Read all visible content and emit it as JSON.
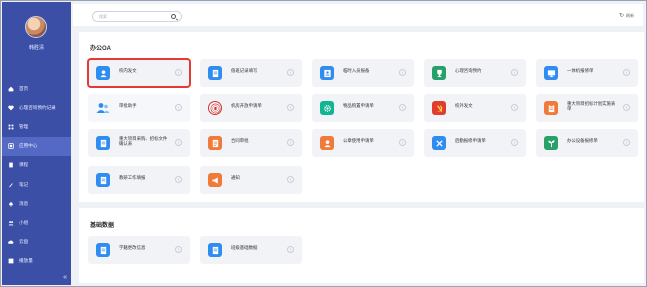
{
  "sidebar": {
    "username": "韩胜清",
    "items": [
      {
        "label": "首页",
        "icon": "home-icon"
      },
      {
        "label": "心理咨询预约记录",
        "icon": "heart-icon"
      },
      {
        "label": "管理",
        "icon": "grid-icon"
      },
      {
        "label": "应用中心",
        "icon": "apps-icon",
        "active": true
      },
      {
        "label": "课程",
        "icon": "book-icon"
      },
      {
        "label": "笔记",
        "icon": "pen-icon"
      },
      {
        "label": "消息",
        "icon": "bell-icon"
      },
      {
        "label": "小组",
        "icon": "group-icon"
      },
      {
        "label": "云盘",
        "icon": "cloud-icon"
      },
      {
        "label": "播放量",
        "icon": "chart-icon"
      }
    ],
    "collapse_label": "«"
  },
  "topbar": {
    "search_placeholder": "搜索",
    "refresh_label": "刷新"
  },
  "sections": [
    {
      "title": "办公OA",
      "cards": [
        {
          "label": "校内发文",
          "color": "#2f8cf0",
          "icon": "user-icon",
          "highlight": true
        },
        {
          "label": "值班记录填写",
          "color": "#2f8cf0",
          "icon": "document-icon"
        },
        {
          "label": "临时入员报备",
          "color": "#2f8cf0",
          "icon": "id-card-icon"
        },
        {
          "label": "心理咨询预约",
          "color": "#27a06a",
          "icon": "trophy-icon"
        },
        {
          "label": "一体机报修单",
          "color": "#2f8cf0",
          "icon": "monitor-icon"
        },
        {
          "label": "审批助手",
          "color": "#2f8cf0",
          "icon": "people-icon"
        },
        {
          "label": "机房开放申请单",
          "color": "#c33333",
          "icon": "emblem-icon"
        },
        {
          "label": "物品购置申请单",
          "color": "#11b593",
          "icon": "gear-icon"
        },
        {
          "label": "校外发文",
          "color": "#e23c2f",
          "icon": "hammer-sickle-icon"
        },
        {
          "label": "重大项目招标计划实施表单",
          "color": "#f07a3a",
          "icon": "clipboard-icon"
        },
        {
          "label": "重大项目采购、招标文件确认表",
          "color": "#2f8cf0",
          "icon": "document-icon"
        },
        {
          "label": "合同审批",
          "color": "#f07a3a",
          "icon": "contract-icon"
        },
        {
          "label": "公章使用申请单",
          "color": "#f07a3a",
          "icon": "seal-icon"
        },
        {
          "label": "后勤报修申请单",
          "color": "#2f8cf0",
          "icon": "tools-icon"
        },
        {
          "label": "办公设备报修单",
          "color": "#27a06a",
          "icon": "plant-icon"
        },
        {
          "label": "教研工作填报",
          "color": "#2f8cf0",
          "icon": "document-icon"
        },
        {
          "label": "通知",
          "color": "#f07a3a",
          "icon": "megaphone-icon"
        }
      ]
    },
    {
      "title": "基础数据",
      "cards": [
        {
          "label": "学籍更改信息",
          "color": "#2f8cf0",
          "icon": "document-icon"
        },
        {
          "label": "班级基础数据",
          "color": "#2f8cf0",
          "icon": "document-icon"
        }
      ]
    }
  ]
}
